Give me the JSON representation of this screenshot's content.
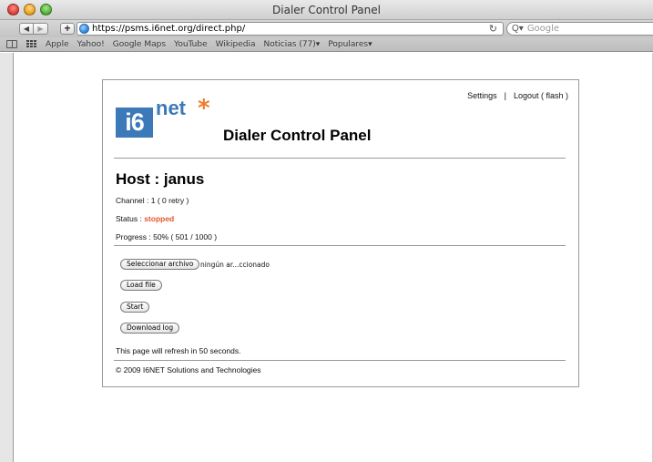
{
  "window": {
    "title": "Dialer Control Panel"
  },
  "toolbar": {
    "url": "https://psms.i6net.org/direct.php/",
    "search_placeholder": "Google"
  },
  "bookmarks": [
    "Apple",
    "Yahoo!",
    "Google Maps",
    "YouTube",
    "Wikipedia",
    "Noticias (77)▾",
    "Populares▾"
  ],
  "header": {
    "settings_link": "Settings",
    "separator": "|",
    "logout_link": "Logout ( flash )"
  },
  "logo": {
    "box_text": "i6",
    "net_text": "net",
    "star": "*"
  },
  "panel": {
    "title": "Dialer Control Panel",
    "host": "Host : janus",
    "channel": "Channel : 1 ( 0 retry )",
    "status_label": "Status : ",
    "status_value": "stopped",
    "progress": "Progress : 50% ( 501 / 1000 )",
    "refresh_notice": "This page will refresh in 50 seconds.",
    "footer": "© 2009 I6NET Solutions and Technologies"
  },
  "controls": {
    "choose_file_button": "Seleccionar archivo",
    "file_status": "ningún ar...ccionado",
    "load_file_button": "Load file",
    "start_button": "Start",
    "download_log_button": "Download log"
  },
  "colors": {
    "brand_blue": "#3c79b8",
    "brand_orange": "#f07c2c",
    "status_stopped": "#e8562a"
  }
}
